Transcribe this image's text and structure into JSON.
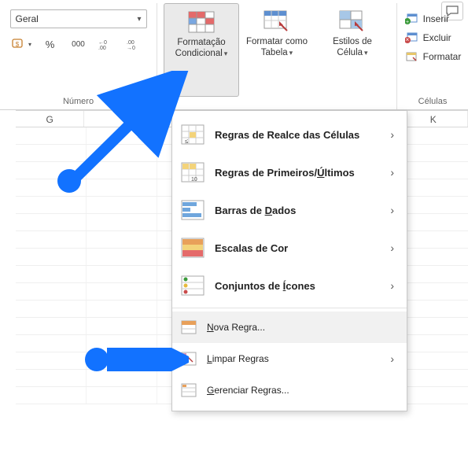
{
  "ribbon": {
    "number_group": {
      "label": "Número",
      "format_select": "Geral",
      "btn_accounting": "$",
      "btn_percent": "%",
      "btn_thousands": "000",
      "btn_inc_dec": "←0",
      "btn_dec_dec": "→0"
    },
    "styles_group": {
      "conditional_formatting": {
        "line1": "Formatação",
        "line2": "Condicional"
      },
      "format_as_table": {
        "line1": "Formatar como",
        "line2": "Tabela"
      },
      "cell_styles": {
        "line1": "Estilos de",
        "line2": "Célula"
      }
    },
    "cells_group": {
      "label": "Células",
      "insert": "Inserir",
      "delete": "Excluir",
      "format": "Formatar"
    }
  },
  "sheet": {
    "columns": [
      "G",
      "",
      "",
      "",
      "K"
    ]
  },
  "dropdown": {
    "highlight_rules": "Regras de Realce das Células",
    "top_bottom_rules": "Regras de Primeiros/",
    "top_bottom_rules_uacute": "Ú",
    "top_bottom_rules_tail": "ltimos",
    "data_bars_pre": "Barras de ",
    "data_bars_mn": "D",
    "data_bars_post": "ados",
    "color_scales": "Escalas de Cor",
    "icon_sets_pre": "Conjuntos de ",
    "icon_sets_mn": "Í",
    "icon_sets_post": "cones",
    "new_rule_mn": "N",
    "new_rule_post": "ova Regra...",
    "clear_rules_mn": "L",
    "clear_rules_post": "impar Regras",
    "manage_rules_mn": "G",
    "manage_rules_post": "erenciar Regras..."
  }
}
